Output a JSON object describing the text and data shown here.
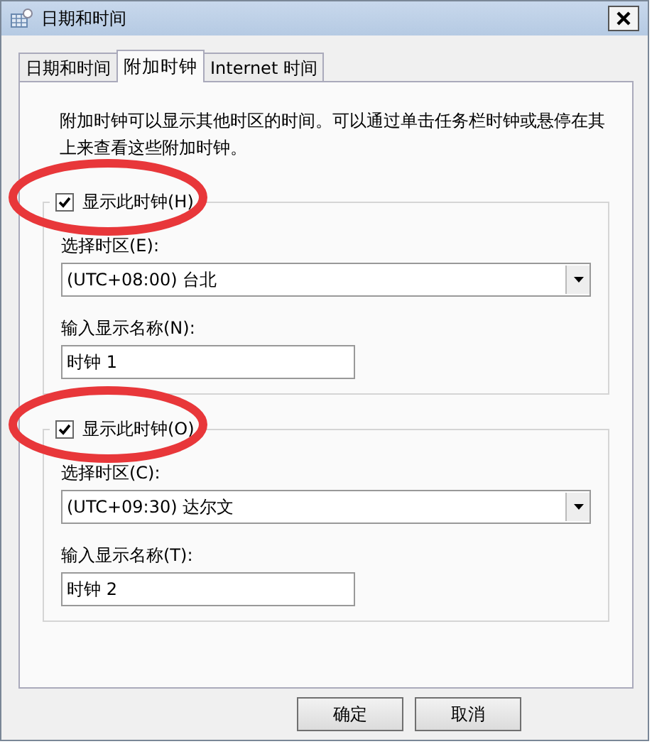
{
  "window": {
    "title": "日期和时间"
  },
  "tabs": [
    {
      "label": "日期和时间",
      "selected": false
    },
    {
      "label": "附加时钟",
      "selected": true
    },
    {
      "label": "Internet 时间",
      "selected": false
    }
  ],
  "description": "附加时钟可以显示其他时区的时间。可以通过单击任务栏时钟或悬停在其上来查看这些附加时钟。",
  "clocks": [
    {
      "show_label": "显示此时钟(H)",
      "checked": true,
      "circled": true,
      "zone_label": "选择时区(E):",
      "zone": "(UTC+08:00) 台北",
      "name_label": "输入显示名称(N):",
      "name": "时钟 1"
    },
    {
      "show_label": "显示此时钟(O)",
      "checked": true,
      "circled": true,
      "zone_label": "选择时区(C):",
      "zone": "(UTC+09:30) 达尔文",
      "name_label": "输入显示名称(T):",
      "name": "时钟 2"
    }
  ],
  "buttons": [
    "确定",
    "取消"
  ]
}
